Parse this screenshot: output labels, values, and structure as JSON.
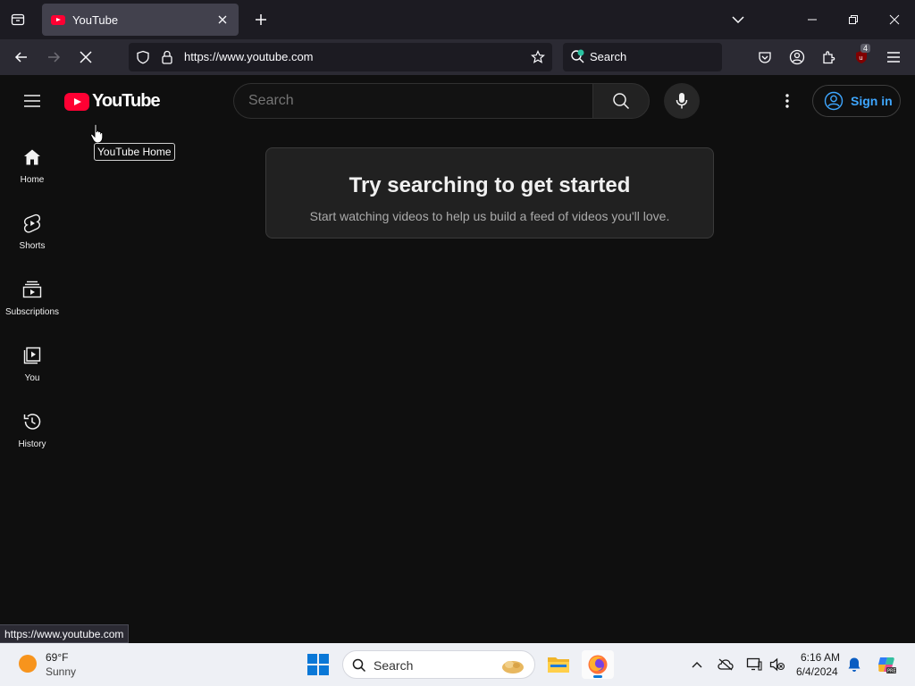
{
  "browser": {
    "tab_title": "YouTube",
    "url_host": "https://www.youtube.com",
    "search_placeholder": "Search",
    "extension_badge": "4"
  },
  "youtube": {
    "logo_text": "YouTube",
    "search_placeholder": "Search",
    "signin_label": "Sign in",
    "tooltip": "YouTube Home",
    "sidebar": [
      {
        "label": "Home",
        "icon": "home-icon"
      },
      {
        "label": "Shorts",
        "icon": "shorts-icon"
      },
      {
        "label": "Subscriptions",
        "icon": "subscriptions-icon"
      },
      {
        "label": "You",
        "icon": "you-icon"
      },
      {
        "label": "History",
        "icon": "history-icon"
      }
    ],
    "empty_state": {
      "title": "Try searching to get started",
      "subtitle": "Start watching videos to help us build a feed of videos you'll love."
    }
  },
  "status_url": "https://www.youtube.com",
  "taskbar": {
    "weather_temp": "69°F",
    "weather_condition": "Sunny",
    "search_placeholder": "Search",
    "time": "6:16 AM",
    "date": "6/4/2024"
  },
  "colors": {
    "youtube_red": "#ff0033",
    "link_blue": "#3ea6ff",
    "background": "#0f0f0f"
  }
}
